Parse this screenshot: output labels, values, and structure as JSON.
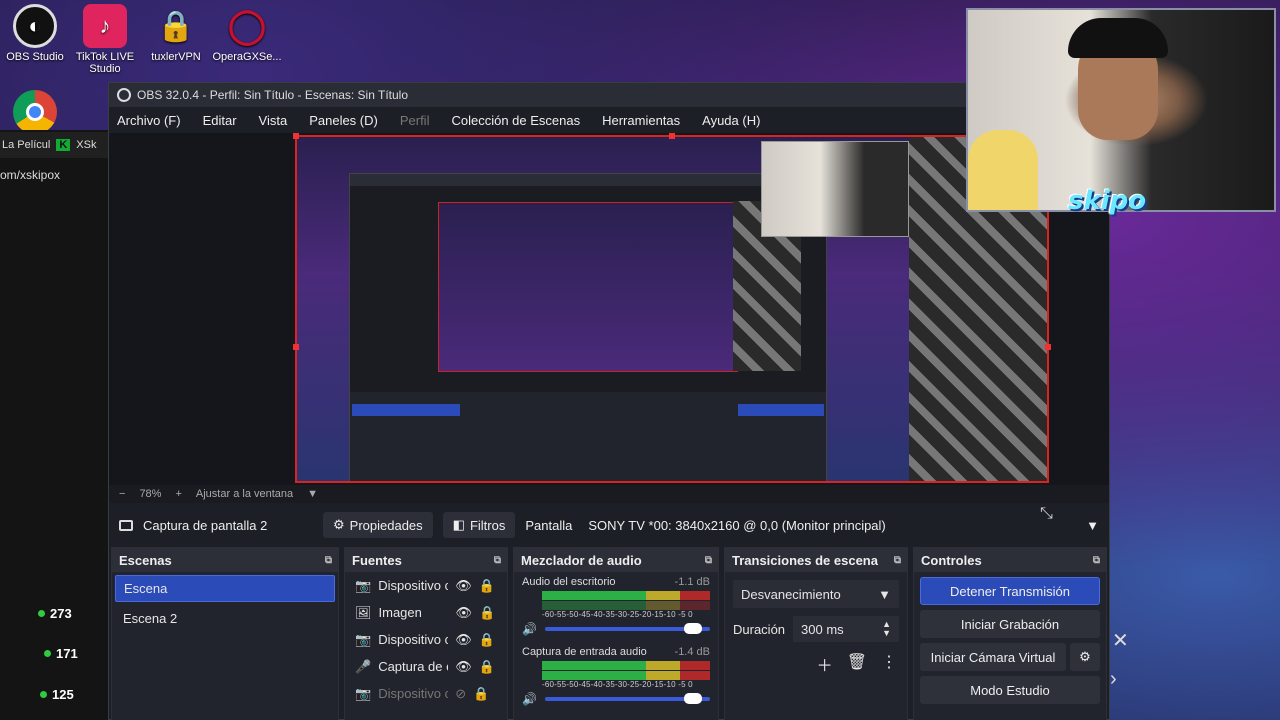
{
  "desktop": {
    "icons": [
      {
        "label": "OBS Studio",
        "icon": "obs-icon",
        "color": "#222"
      },
      {
        "label": "TikTok LIVE Studio",
        "icon": "tiktok-icon",
        "color": "#e0245e"
      },
      {
        "label": "tuxlerVPN",
        "icon": "vpn-lock-icon",
        "color": "#b08040"
      },
      {
        "label": "OperaGXSe...",
        "icon": "opera-gx-icon",
        "color": "#c8102e"
      }
    ],
    "browser_tab_1": "La Películ",
    "browser_tab_2": "XSk",
    "browser_url": "om/xskipox",
    "viewers": [
      "273",
      "171",
      "125"
    ]
  },
  "obs": {
    "title": "OBS 32.0.4 - Perfil: Sin Título - Escenas: Sin Título",
    "menu": [
      "Archivo (F)",
      "Editar",
      "Vista",
      "Paneles (D)",
      "Perfil",
      "Colección de Escenas",
      "Herramientas",
      "Ayuda (H)"
    ],
    "zoom": {
      "minus": "−",
      "value": "78%",
      "plus": "+",
      "fit": "Ajustar a la ventana"
    },
    "source_bar": {
      "source_name": "Captura de pantalla 2",
      "properties": "Propiedades",
      "filters": "Filtros",
      "display_label": "Pantalla",
      "display_value": "SONY TV  *00: 3840x2160 @ 0,0 (Monitor principal)"
    },
    "scenes": {
      "title": "Escenas",
      "items": [
        "Escena",
        "Escena 2"
      ]
    },
    "sources": {
      "title": "Fuentes",
      "items": [
        {
          "name": "Dispositivo c",
          "icon": "camera-icon"
        },
        {
          "name": "Imagen",
          "icon": "image-icon"
        },
        {
          "name": "Dispositivo c",
          "icon": "camera-icon"
        },
        {
          "name": "Captura de e",
          "icon": "microphone-icon"
        },
        {
          "name": "Dispositivo c",
          "icon": "camera-icon"
        }
      ]
    },
    "mixer": {
      "title": "Mezclador de audio",
      "scale": "-60-55-50-45-40-35-30-25-20-15-10 -5  0",
      "channels": [
        {
          "name": "Audio del escritorio",
          "db": "-1.1 dB"
        },
        {
          "name": "Captura de entrada audio",
          "db": "-1.4 dB"
        }
      ]
    },
    "transitions": {
      "title": "Transiciones de escena",
      "selected": "Desvanecimiento",
      "duration_label": "Duración",
      "duration_value": "300 ms"
    },
    "controls": {
      "title": "Controles",
      "buttons": [
        "Detener Transmisión",
        "Iniciar Grabación",
        "Iniciar Cámara Virtual",
        "Modo Estudio"
      ]
    }
  },
  "overlay": {
    "webcam_label": "skipo"
  },
  "colors": {
    "accent": "#2b4bb8",
    "preview_border": "#dd2222",
    "viewer_dot": "#2ecc40"
  }
}
